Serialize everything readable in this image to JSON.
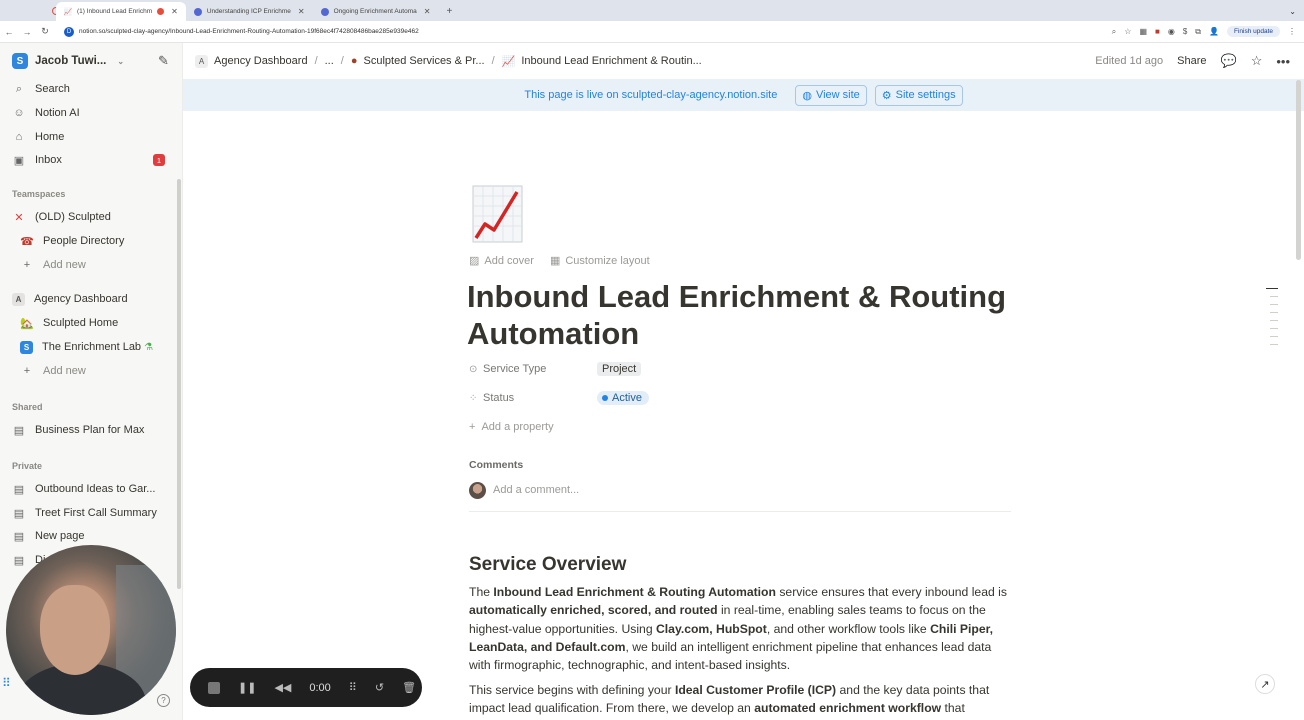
{
  "browser": {
    "tabs": [
      {
        "label": "(1) Inbound Lead Enrichm",
        "active": true
      },
      {
        "label": "Understanding ICP Enrichme",
        "active": false
      },
      {
        "label": "Ongoing Enrichment Automa",
        "active": false
      }
    ],
    "url": "notion.so/sculpted-clay-agency/Inbound-Lead-Enrichment-Routing-Automation-19f68ec4f742808486bae285e939e462",
    "finish_update": "Finish update"
  },
  "sidebar": {
    "workspace": "Jacob Tuwi...",
    "items_top": [
      {
        "label": "Search",
        "icon": "search-icon"
      },
      {
        "label": "Notion AI",
        "icon": "notion-ai-icon"
      },
      {
        "label": "Home",
        "icon": "home-icon"
      },
      {
        "label": "Inbox",
        "icon": "inbox-icon",
        "badge": "1"
      }
    ],
    "teamspaces_label": "Teamspaces",
    "teamspaces": [
      {
        "label": "(OLD) Sculpted"
      },
      {
        "label": "People Directory"
      },
      {
        "label": "Add new"
      },
      {
        "label": "Agency Dashboard"
      },
      {
        "label": "Sculpted Home"
      },
      {
        "label": "The Enrichment Lab"
      },
      {
        "label": "Add new"
      }
    ],
    "shared_label": "Shared",
    "shared": [
      {
        "label": "Business Plan for Max"
      }
    ],
    "private_label": "Private",
    "private": [
      {
        "label": "Outbound Ideas to Gar..."
      },
      {
        "label": "Treet First Call Summary"
      },
      {
        "label": "New page"
      },
      {
        "label": "Di..."
      }
    ]
  },
  "recorder": {
    "time": "0:00"
  },
  "topbar": {
    "crumbs": [
      "Agency Dashboard",
      "...",
      "Sculpted Services & Pr...",
      "Inbound Lead Enrichment & Routin..."
    ],
    "edited": "Edited 1d ago",
    "share": "Share"
  },
  "livebar": {
    "message": "This page is live on sculpted-clay-agency.notion.site",
    "view_site": "View site",
    "site_settings": "Site settings"
  },
  "page": {
    "add_cover": "Add cover",
    "customize_layout": "Customize layout",
    "title": "Inbound Lead Enrichment & Routing Automation",
    "properties": [
      {
        "name": "Service Type",
        "value": "Project"
      },
      {
        "name": "Status",
        "value": "Active"
      }
    ],
    "add_property": "Add a property",
    "comments_label": "Comments",
    "comment_placeholder": "Add a comment...",
    "section_heading": "Service Overview",
    "p1": {
      "a": "The ",
      "b": "Inbound Lead Enrichment & Routing Automation",
      "c": " service ensures that every inbound lead is ",
      "d": "automatically enriched, scored, and routed",
      "e": " in real-time, enabling sales teams to focus on the highest-value opportunities. Using ",
      "f": "Clay.com, HubSpot",
      "g": ", and other workflow tools like ",
      "h": "Chili Piper, LeanData, and Default.com",
      "i": ", we build an intelligent enrichment pipeline that enhances lead data with firmographic, technographic, and intent-based insights."
    },
    "p2": {
      "a": "This service begins with defining your ",
      "b": "Ideal Customer Profile (ICP)",
      "c": " and the key data points that impact lead qualification. From there, we develop an ",
      "d": "automated enrichment workflow",
      "e": " that"
    }
  }
}
